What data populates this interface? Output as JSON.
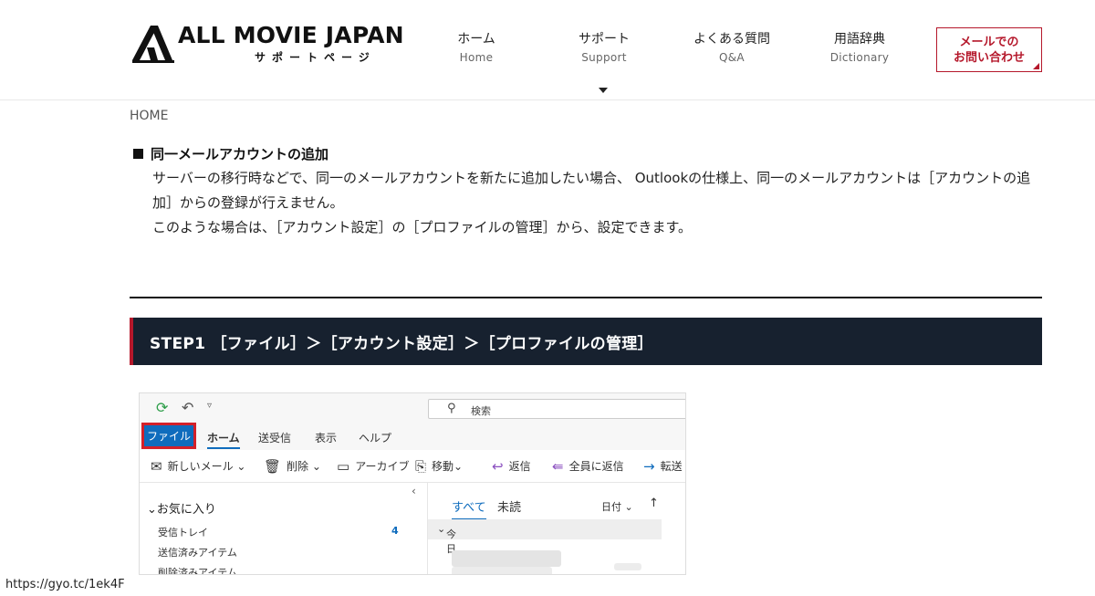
{
  "header": {
    "logo_title": "ALL MOVIE JAPAN",
    "logo_sub": "サポートページ",
    "nav": [
      {
        "jp": "ホーム",
        "en": "Home"
      },
      {
        "jp": "サポート",
        "en": "Support"
      },
      {
        "jp": "よくある質問",
        "en": "Q&A"
      },
      {
        "jp": "用語辞典",
        "en": "Dictionary"
      }
    ],
    "mail_line1": "メールでの",
    "mail_line2": "お問い合わせ"
  },
  "breadcrumb": "HOME",
  "section": {
    "heading": "同一メールアカウントの追加",
    "para1": "サーバーの移行時などで、同一のメールアカウントを新たに追加したい場合、 Outlookの仕様上、同一のメールアカウントは［アカウントの追加］からの登録が行えません。",
    "para2": "このような場合は、［アカウント設定］の［プロファイルの管理］から、設定できます。"
  },
  "step": {
    "title": "STEP1 ［ファイル］＞［アカウント設定］＞［プロファイルの管理］"
  },
  "outlook": {
    "search": "検索",
    "tabs": [
      "ファイル",
      "ホーム",
      "送受信",
      "表示",
      "ヘルプ"
    ],
    "ribbon": [
      "新しいメール",
      "削除",
      "アーカイブ",
      "移動",
      "返信",
      "全員に返信",
      "転送"
    ],
    "favorites": "お気に入り",
    "folders": [
      "受信トレイ",
      "送信済みアイテム",
      "削除済みアイテム"
    ],
    "inbox_count": "4",
    "mail_tabs": [
      "すべて",
      "未読"
    ],
    "sort": "日付",
    "today": "今日"
  },
  "status_url": "https://gyo.tc/1ek4F",
  "colors": {
    "accent": "#b5182b",
    "dark": "#17212f",
    "outlook_blue": "#0f6cbd"
  }
}
